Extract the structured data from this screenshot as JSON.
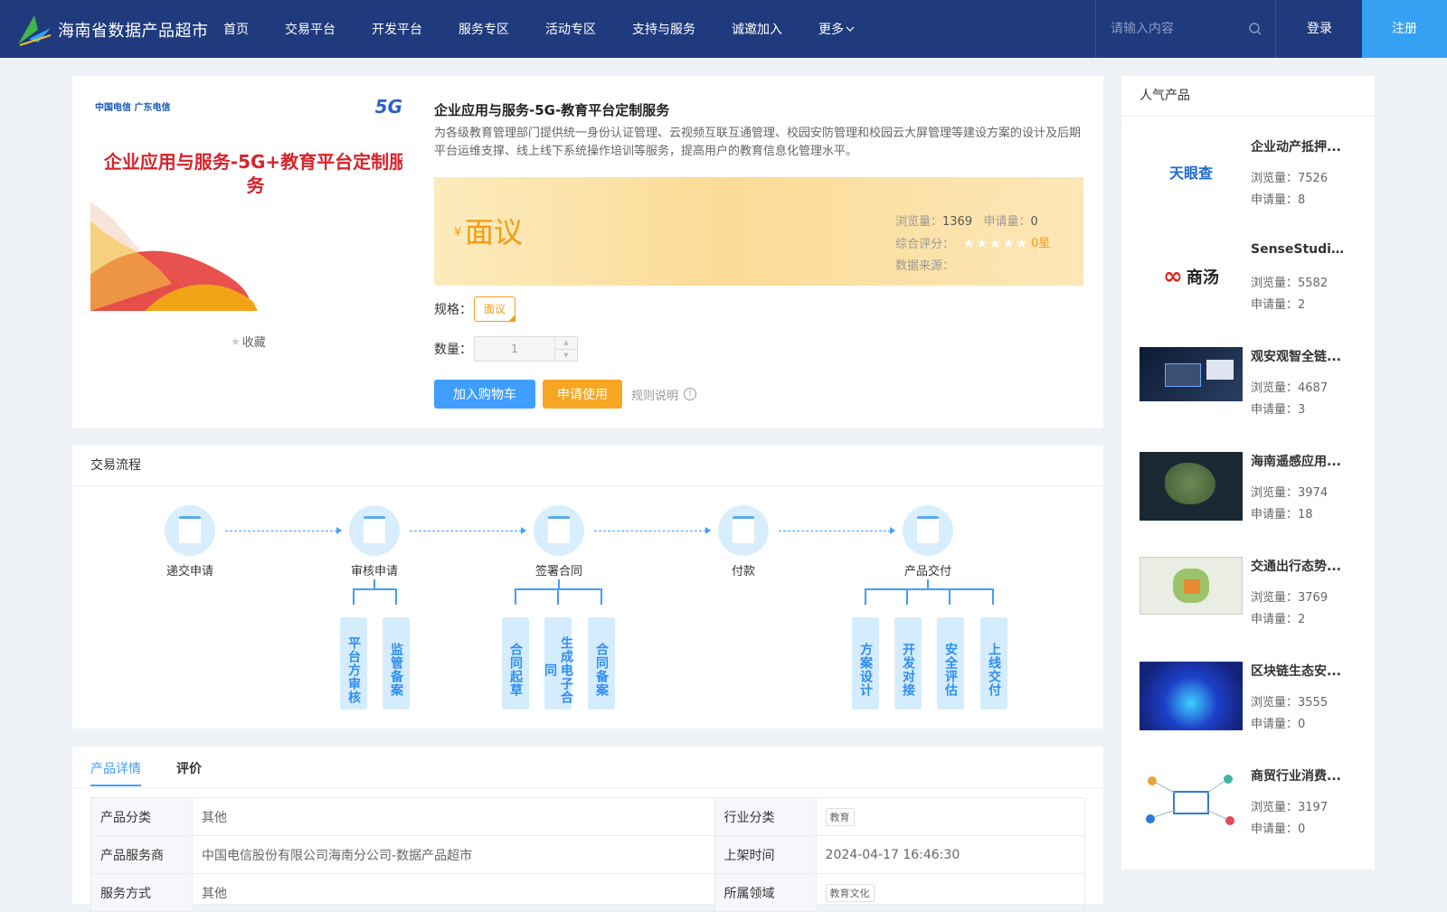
{
  "header": {
    "site_name": "海南省数据产品超市",
    "nav": [
      "首页",
      "交易平台",
      "开发平台",
      "服务专区",
      "活动专区",
      "支持与服务",
      "诚邀加入",
      "更多"
    ],
    "search_placeholder": "请输入内容",
    "login": "登录",
    "register": "注册",
    "brand_color": "#1f3a7d",
    "accent_color": "#36a1f3"
  },
  "product": {
    "image_brand": "中国电信 广东电信",
    "image_badge": "5G",
    "image_title": "企业应用与服务-5G+教育平台定制服务",
    "favorite": "收藏",
    "title": "企业应用与服务-5G-教育平台定制服务",
    "description": "为各级教育管理部门提供统一身份认证管理、云视频互联互通管理、校园安防管理和校园云大屏管理等建设方案的设计及后期平台运维支撑、线上线下系统操作培训等服务，提高用户的教育信息化管理水平。",
    "currency": "¥",
    "price": "面议",
    "views_label": "浏览量：",
    "views": "1369",
    "applies_label": "申请量：",
    "applies": "0",
    "rating_label": "综合评分：",
    "rating": 0,
    "rating_text": "0星",
    "source_label": "数据来源：",
    "spec_label": "规格：",
    "spec_value": "面议",
    "qty_label": "数量：",
    "qty_value": "1",
    "add_cart": "加入购物车",
    "apply": "申请使用",
    "rules": "规则说明"
  },
  "flow": {
    "title": "交易流程",
    "steps": [
      "递交申请",
      "审核申请",
      "签署合同",
      "付款",
      "产品交付"
    ],
    "sub_audit": [
      "平台方审核",
      "监管备案"
    ],
    "sub_contract": [
      "合同起草",
      "生成电子合同",
      "合同备案"
    ],
    "sub_delivery": [
      "方案设计",
      "开发对接",
      "安全评估",
      "上线交付"
    ]
  },
  "detail": {
    "tabs": [
      "产品详情",
      "评价"
    ],
    "rows": [
      {
        "k1": "产品分类",
        "v1": "其他",
        "k2": "行业分类",
        "v2": "教育"
      },
      {
        "k1": "产品服务商",
        "v1": "中国电信股份有限公司海南分公司-数据产品超市",
        "k2": "上架时间",
        "v2": "2024-04-17 16:46:30"
      },
      {
        "k1": "服务方式",
        "v1": "其他",
        "k2": "所属领域",
        "v2": "教育文化"
      }
    ]
  },
  "sidebar": {
    "title": "人气产品",
    "views_label": "浏览量：",
    "applies_label": "申请量：",
    "items": [
      {
        "name": "企业动产抵押...",
        "views": "7526",
        "applies": "8",
        "thumb": "天眼查"
      },
      {
        "name": "SenseStudio...",
        "views": "5582",
        "applies": "2",
        "thumb": "商汤"
      },
      {
        "name": "观安观智全链...",
        "views": "4687",
        "applies": "3",
        "thumb": ""
      },
      {
        "name": "海南遥感应用...",
        "views": "3974",
        "applies": "18",
        "thumb": ""
      },
      {
        "name": "交通出行态势...",
        "views": "3769",
        "applies": "2",
        "thumb": ""
      },
      {
        "name": "区块链生态安...",
        "views": "3555",
        "applies": "0",
        "thumb": ""
      },
      {
        "name": "商贸行业消费...",
        "views": "3197",
        "applies": "0",
        "thumb": ""
      }
    ]
  }
}
